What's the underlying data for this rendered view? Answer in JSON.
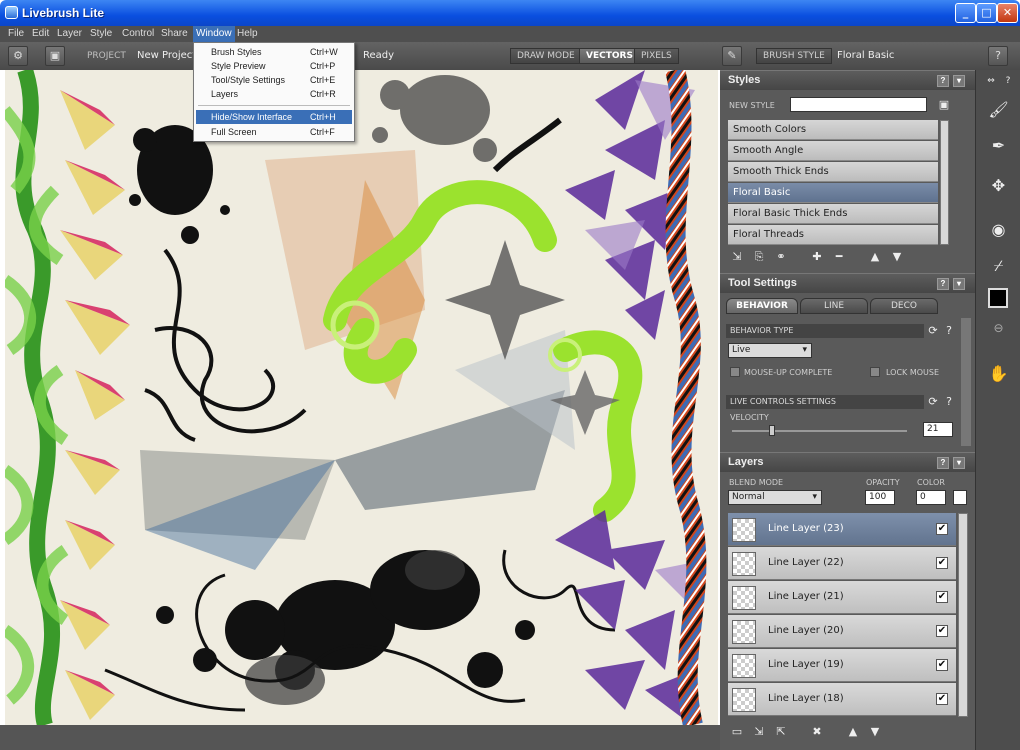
{
  "window": {
    "title": "Livebrush Lite",
    "minimize": "_",
    "maximize": "□",
    "close": "✕"
  },
  "menu": [
    "File",
    "Edit",
    "Layer",
    "Style",
    "Control",
    "Share",
    "Window",
    "Help"
  ],
  "toolbar": {
    "project_label": "PROJECT",
    "project_value": "New Project",
    "status": "Ready",
    "draw_mode_label": "DRAW MODE",
    "vectors": "VECTORS",
    "pixels": "PIXELS",
    "brush_style_label": "BRUSH STYLE",
    "brush_style_value": "Floral Basic",
    "help": "?"
  },
  "window_menu": [
    {
      "label": "Brush Styles",
      "shortcut": "Ctrl+W"
    },
    {
      "label": "Style Preview",
      "shortcut": "Ctrl+P"
    },
    {
      "label": "Tool/Style Settings",
      "shortcut": "Ctrl+E"
    },
    {
      "label": "Layers",
      "shortcut": "Ctrl+R"
    },
    {
      "label": "Hide/Show Interface",
      "shortcut": "Ctrl+H"
    },
    {
      "label": "Full Screen",
      "shortcut": "Ctrl+F"
    }
  ],
  "styles_panel": {
    "title": "Styles",
    "new_style_label": "NEW STYLE",
    "new_style_value": "",
    "items": [
      "Smooth Colors",
      "Smooth Angle",
      "Smooth Thick Ends",
      "Floral Basic",
      "Floral Basic Thick Ends",
      "Floral Threads"
    ],
    "selected": "Floral Basic"
  },
  "tool_settings": {
    "title": "Tool Settings",
    "tabs": [
      "BEHAVIOR",
      "LINE",
      "DECO"
    ],
    "active_tab": "BEHAVIOR",
    "behavior_type_label": "BEHAVIOR TYPE",
    "behavior_type_value": "Live",
    "mouse_up_complete": "MOUSE-UP COMPLETE",
    "lock_mouse": "LOCK MOUSE",
    "live_controls_label": "LIVE CONTROLS SETTINGS",
    "velocity_label": "VELOCITY",
    "velocity_value": "21"
  },
  "layers_panel": {
    "title": "Layers",
    "blend_mode_label": "BLEND MODE",
    "blend_mode_value": "Normal",
    "opacity_label": "OPACITY",
    "opacity_value": "100",
    "color_label": "COLOR",
    "color_value": "0",
    "layers": [
      "Line Layer (23)",
      "Line Layer (22)",
      "Line Layer (21)",
      "Line Layer (20)",
      "Line Layer (19)",
      "Line Layer (18)"
    ],
    "selected": "Line Layer (23)",
    "check": "✔"
  },
  "tools": [
    "brush-tool",
    "pen-tool",
    "transform-tool",
    "fill-tool",
    "eyedropper-tool",
    "color-swatch",
    "link-tool",
    "hand-tool"
  ],
  "colors": {
    "accent": "#3a6fb7",
    "canvas": "#efece0",
    "panel": "#5a5a5a"
  }
}
